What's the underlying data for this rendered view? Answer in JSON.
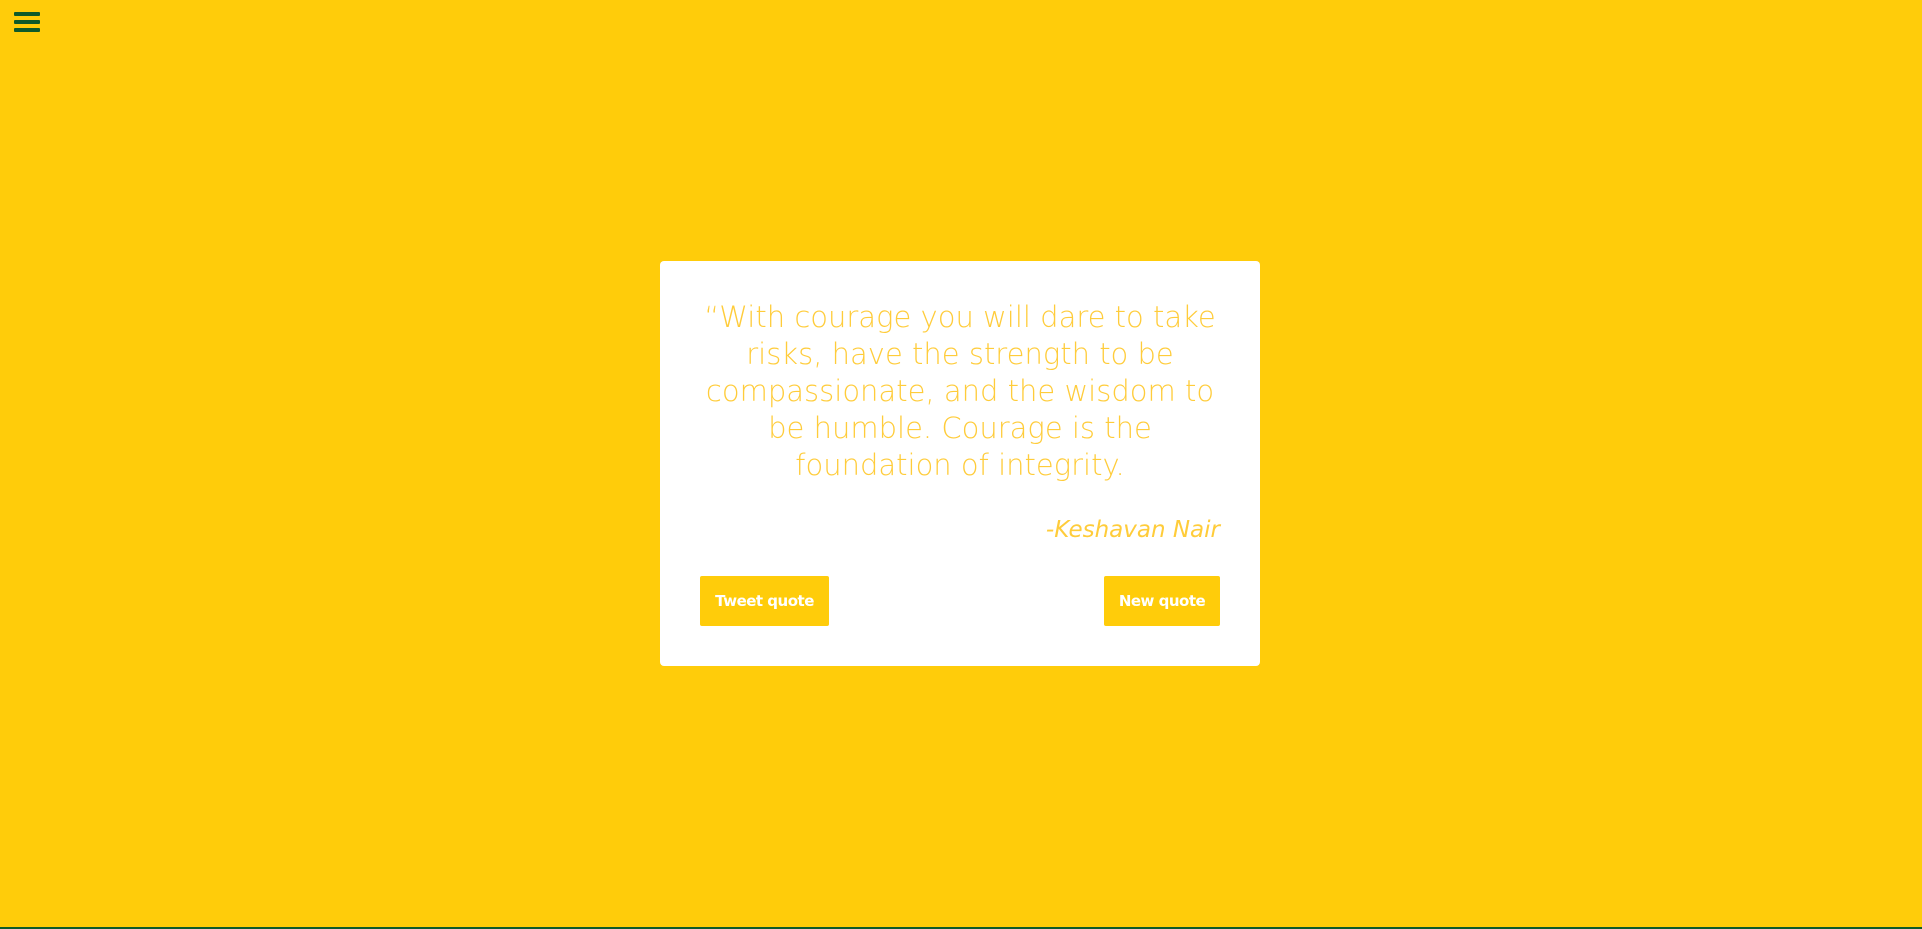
{
  "quote": {
    "text": "“With courage you will dare to take risks, have the strength to be compassionate, and the wisdom to be humble. Courage is the foundation of integrity.",
    "author": "-Keshavan Nair"
  },
  "buttons": {
    "tweet_label": "Tweet quote",
    "new_label": "New quote"
  },
  "icons": {
    "menu": "hamburger-menu-icon"
  },
  "colors": {
    "background": "#FFCC0A",
    "card": "#FFFFFF",
    "quote_text": "#FFCC3A",
    "menu_icon": "#0E5A2A",
    "button_text": "#FFFFFF"
  }
}
